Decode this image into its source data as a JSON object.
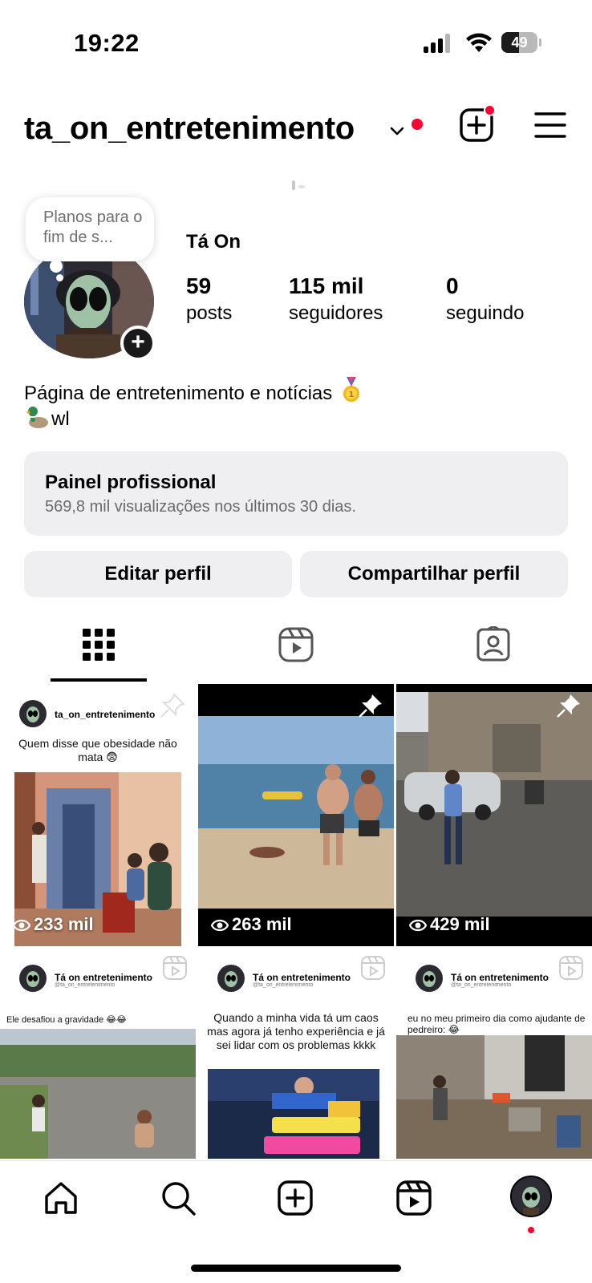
{
  "status_bar": {
    "time": "19:22",
    "battery": "49",
    "battery_level": 0.49
  },
  "header": {
    "username": "ta_on_entretenimento"
  },
  "profile": {
    "note": "Planos para o fim de s...",
    "display_name": "Tá On",
    "stats": [
      {
        "value": "59",
        "label": "posts"
      },
      {
        "value": "115 mil",
        "label": "seguidores"
      },
      {
        "value": "0",
        "label": "seguindo"
      }
    ],
    "bio_line1": "Página de entretenimento e notícias",
    "bio_line2": "wl"
  },
  "dashboard": {
    "title": "Painel profissional",
    "subtitle": "569,8 mil visualizações nos últimos 30 dias."
  },
  "buttons": {
    "edit": "Editar perfil",
    "share": "Compartilhar perfil"
  },
  "tabs": [
    "grid-icon",
    "reels-icon",
    "tagged-icon"
  ],
  "grid": [
    {
      "views": "233 mil",
      "pinned": true,
      "account": "ta_on_entretenimento",
      "caption": "Quem disse que obesidade não mata 😨"
    },
    {
      "views": "263 mil",
      "pinned": true
    },
    {
      "views": "429 mil",
      "pinned": true
    },
    {
      "account": "Tá on entretenimento",
      "handle": "@ta_on_entretenimento",
      "caption": "Ele desafiou a gravidade 😂😂"
    },
    {
      "account": "Tá on entretenimento",
      "handle": "@ta_on_entretenimento",
      "caption": "Quando a minha vida tá um caos mas agora já tenho experiência e já sei lidar com os problemas kkkk"
    },
    {
      "account": "Tá on entretenimento",
      "handle": "@ta_on_entretenimento",
      "caption": "eu no meu primeiro dia como ajudante de pedreiro: 😂"
    }
  ],
  "bottom_nav": [
    "home-icon",
    "search-icon",
    "create-icon",
    "reels-icon",
    "profile-avatar"
  ],
  "colors": {
    "accent_red": "#ff0033",
    "panel_gray": "#efeff1"
  }
}
